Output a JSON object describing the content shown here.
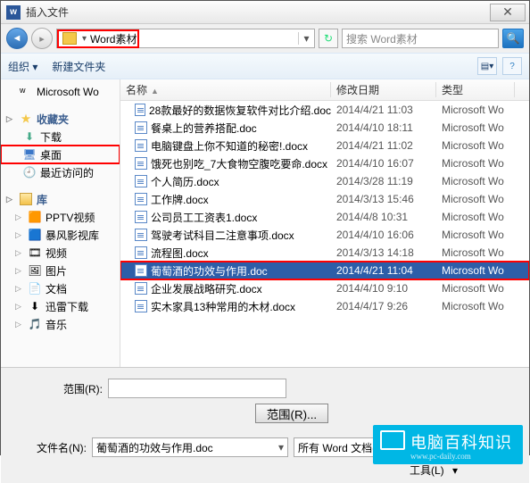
{
  "dialog_title": "插入文件",
  "path_segment": "Word素材",
  "search_placeholder": "搜索 Word素材",
  "toolbar": {
    "organize": "组织 ▾",
    "new_folder": "新建文件夹"
  },
  "tree": {
    "msword": "Microsoft Wo",
    "fav_header": "收藏夹",
    "fav_downloads": "下载",
    "fav_desktop": "桌面",
    "fav_recent": "最近访问的",
    "lib_header": "库",
    "lib_pptv": "PPTV视频",
    "lib_storm": "暴风影视库",
    "lib_video": "视频",
    "lib_pics": "图片",
    "lib_docs": "文档",
    "lib_xunlei": "迅雷下载",
    "lib_music": "音乐"
  },
  "columns": {
    "name": "名称",
    "date": "修改日期",
    "type": "类型"
  },
  "files": [
    {
      "name": "28款最好的数据恢复软件对比介绍.doc",
      "date": "2014/4/21 11:03",
      "type": "Microsoft Wo"
    },
    {
      "name": "餐桌上的营养搭配.doc",
      "date": "2014/4/10 18:11",
      "type": "Microsoft Wo"
    },
    {
      "name": "电脑键盘上你不知道的秘密!.docx",
      "date": "2014/4/21 11:02",
      "type": "Microsoft Wo"
    },
    {
      "name": "饿死也别吃_7大食物空腹吃要命.docx",
      "date": "2014/4/10 16:07",
      "type": "Microsoft Wo"
    },
    {
      "name": "个人简历.docx",
      "date": "2014/3/28 11:19",
      "type": "Microsoft Wo"
    },
    {
      "name": "工作牌.docx",
      "date": "2014/3/13 15:46",
      "type": "Microsoft Wo"
    },
    {
      "name": "公司员工工资表1.docx",
      "date": "2014/4/8 10:31",
      "type": "Microsoft Wo"
    },
    {
      "name": "驾驶考试科目二注意事项.docx",
      "date": "2014/4/10 16:06",
      "type": "Microsoft Wo"
    },
    {
      "name": "流程图.docx",
      "date": "2014/3/13 14:18",
      "type": "Microsoft Wo"
    },
    {
      "name": "葡萄酒的功效与作用.doc",
      "date": "2014/4/21 11:04",
      "type": "Microsoft Wo"
    },
    {
      "name": "企业发展战略研究.docx",
      "date": "2014/4/10 9:10",
      "type": "Microsoft Wo"
    },
    {
      "name": "实木家具13种常用的木材.docx",
      "date": "2014/4/17 9:26",
      "type": "Microsoft Wo"
    }
  ],
  "footer": {
    "range_label": "范围(R):",
    "range_button": "范围(R)...",
    "filename_label": "文件名(N):",
    "filename_value": "葡萄酒的功效与作用.doc",
    "filter": "所有 Word 文档(*.docx;*.doc;",
    "tools": "工具(L)"
  },
  "watermark": {
    "title": "电脑百科知识",
    "sub": "www.pc-daily.com"
  }
}
